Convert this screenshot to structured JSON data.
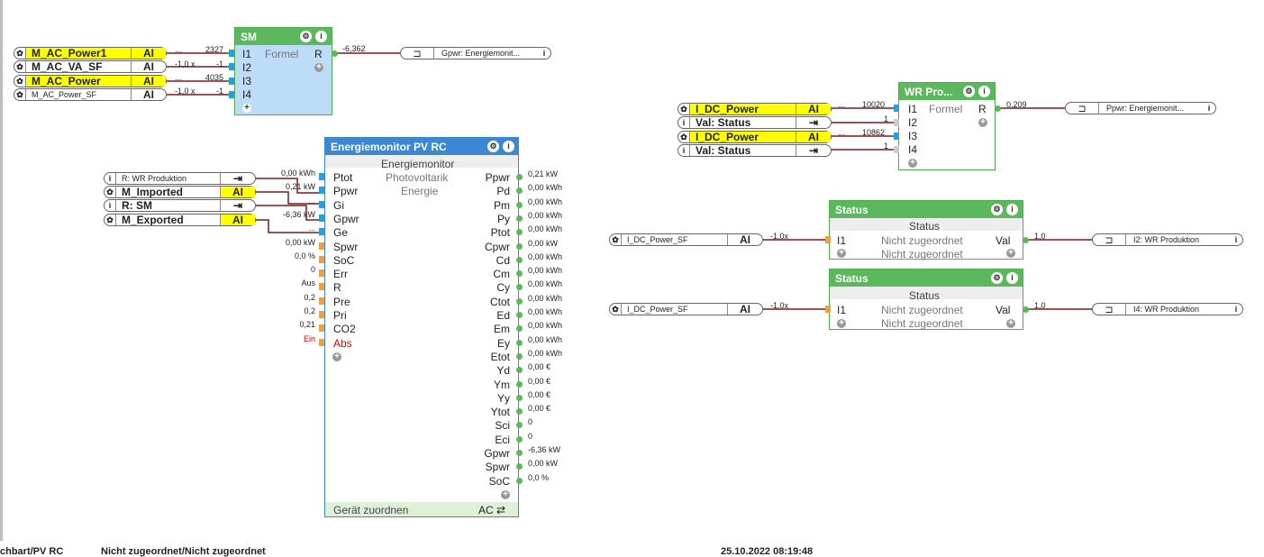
{
  "inputs_sm": [
    {
      "name": "M_AC_Power1",
      "type": "AI",
      "value": "2327",
      "prefix": "..."
    },
    {
      "name": "M_AC_VA_SF",
      "type": "AI",
      "value": "-1",
      "prefix": "-1,0 x"
    },
    {
      "name": "M_AC_Power",
      "type": "AI",
      "value": "4035",
      "prefix": "..."
    },
    {
      "name": "M_AC_Power_SF",
      "type": "AI",
      "value": "-1",
      "prefix": "-1,0 x"
    }
  ],
  "sm_block": {
    "title": "SM",
    "subtitle": "Formel",
    "inputs": [
      "I1",
      "I2",
      "I3",
      "I4"
    ],
    "output": "R",
    "output_value": "-6,362",
    "target": "Gpwr: Energiemonit..."
  },
  "inputs_em": [
    {
      "name": "R: WR Produktion",
      "type": "",
      "value": "0,00 kWh"
    },
    {
      "name": "M_Imported",
      "type": "AI",
      "value": "0,21 kW"
    },
    {
      "name": "R: SM",
      "type": "",
      "value": "..."
    },
    {
      "name": "M_Exported",
      "type": "AI",
      "value": "-6,36 kW"
    }
  ],
  "em_block": {
    "title": "Energiemonitor PV RC",
    "subtitle": "Energiemonitor",
    "desc1": "Photovoltarik",
    "desc2": "Energie",
    "inputs": [
      {
        "label": "Ptot",
        "value": "0,00 kWh"
      },
      {
        "label": "Ppwr",
        "value": "0,21 kW"
      },
      {
        "label": "Gi",
        "value": "..."
      },
      {
        "label": "Gpwr",
        "value": "-6,36 kW"
      },
      {
        "label": "Ge",
        "value": "..."
      },
      {
        "label": "Spwr",
        "value": "0,00 kW"
      },
      {
        "label": "SoC",
        "value": "0,0 %"
      },
      {
        "label": "Err",
        "value": "0"
      },
      {
        "label": "R",
        "value": "Aus"
      },
      {
        "label": "Pre",
        "value": "0,2"
      },
      {
        "label": "Pri",
        "value": "0,2"
      },
      {
        "label": "CO2",
        "value": "0,21"
      },
      {
        "label": "Abs",
        "value": "Ein"
      }
    ],
    "outputs": [
      {
        "label": "Ppwr",
        "value": "0,21 kW"
      },
      {
        "label": "Pd",
        "value": "0,00 kWh"
      },
      {
        "label": "Pm",
        "value": "0,00 kWh"
      },
      {
        "label": "Py",
        "value": "0,00 kWh"
      },
      {
        "label": "Ptot",
        "value": "0,00 kWh"
      },
      {
        "label": "Cpwr",
        "value": "0,00 kW"
      },
      {
        "label": "Cd",
        "value": "0,00 kWh"
      },
      {
        "label": "Cm",
        "value": "0,00 kWh"
      },
      {
        "label": "Cy",
        "value": "0,00 kWh"
      },
      {
        "label": "Ctot",
        "value": "0,00 kWh"
      },
      {
        "label": "Ed",
        "value": "0,00 kWh"
      },
      {
        "label": "Em",
        "value": "0,00 kWh"
      },
      {
        "label": "Ey",
        "value": "0,00 kWh"
      },
      {
        "label": "Etot",
        "value": "0,00 kWh"
      },
      {
        "label": "Yd",
        "value": "0,00 €"
      },
      {
        "label": "Ym",
        "value": "0,00 €"
      },
      {
        "label": "Yy",
        "value": "0,00 €"
      },
      {
        "label": "Ytot",
        "value": "0,00 €"
      },
      {
        "label": "Sci",
        "value": "0"
      },
      {
        "label": "Eci",
        "value": "0"
      },
      {
        "label": "Gpwr",
        "value": "-6,36 kW"
      },
      {
        "label": "Spwr",
        "value": "0,00 kW"
      },
      {
        "label": "SoC",
        "value": "0,0 %"
      }
    ],
    "footer": "Gerät zuordnen",
    "footer_right": "AC ⇄"
  },
  "inputs_wr": [
    {
      "name": "I_DC_Power",
      "type": "AI",
      "value": "10020",
      "prefix": "..."
    },
    {
      "name": "Val: Status",
      "type": "",
      "value": "1"
    },
    {
      "name": "I_DC_Power",
      "type": "AI",
      "value": "10862",
      "prefix": "..."
    },
    {
      "name": "Val: Status",
      "type": "",
      "value": "1"
    }
  ],
  "wr_block": {
    "title": "WR Pro...",
    "subtitle": "Formel",
    "inputs": [
      "I1",
      "I2",
      "I3",
      "I4"
    ],
    "output": "R",
    "output_value": "0,209",
    "target": "Ppwr: Energiemonit..."
  },
  "status_blocks": [
    {
      "title": "Status",
      "sub": "Status",
      "input": "I1",
      "mid1": "Nicht zugeordnet",
      "mid2": "Nicht zugeordnet",
      "output": "Val",
      "out_value": "1,0",
      "src": "I_DC_Power_SF",
      "src_type": "AI",
      "src_value": "-1,0x",
      "target": "I2: WR Produktion"
    },
    {
      "title": "Status",
      "sub": "Status",
      "input": "I1",
      "mid1": "Nicht zugeordnet",
      "mid2": "Nicht zugeordnet",
      "output": "Val",
      "out_value": "1,0",
      "src": "I_DC_Power_SF",
      "src_type": "AI",
      "src_value": "-1,0x",
      "target": "I4: WR Produktion"
    }
  ],
  "statusbar": {
    "left": "chbart/PV RC",
    "middle": "Nicht zugeordnet/Nicht zugeordnet",
    "right": "25.10.2022 08:19:48"
  }
}
